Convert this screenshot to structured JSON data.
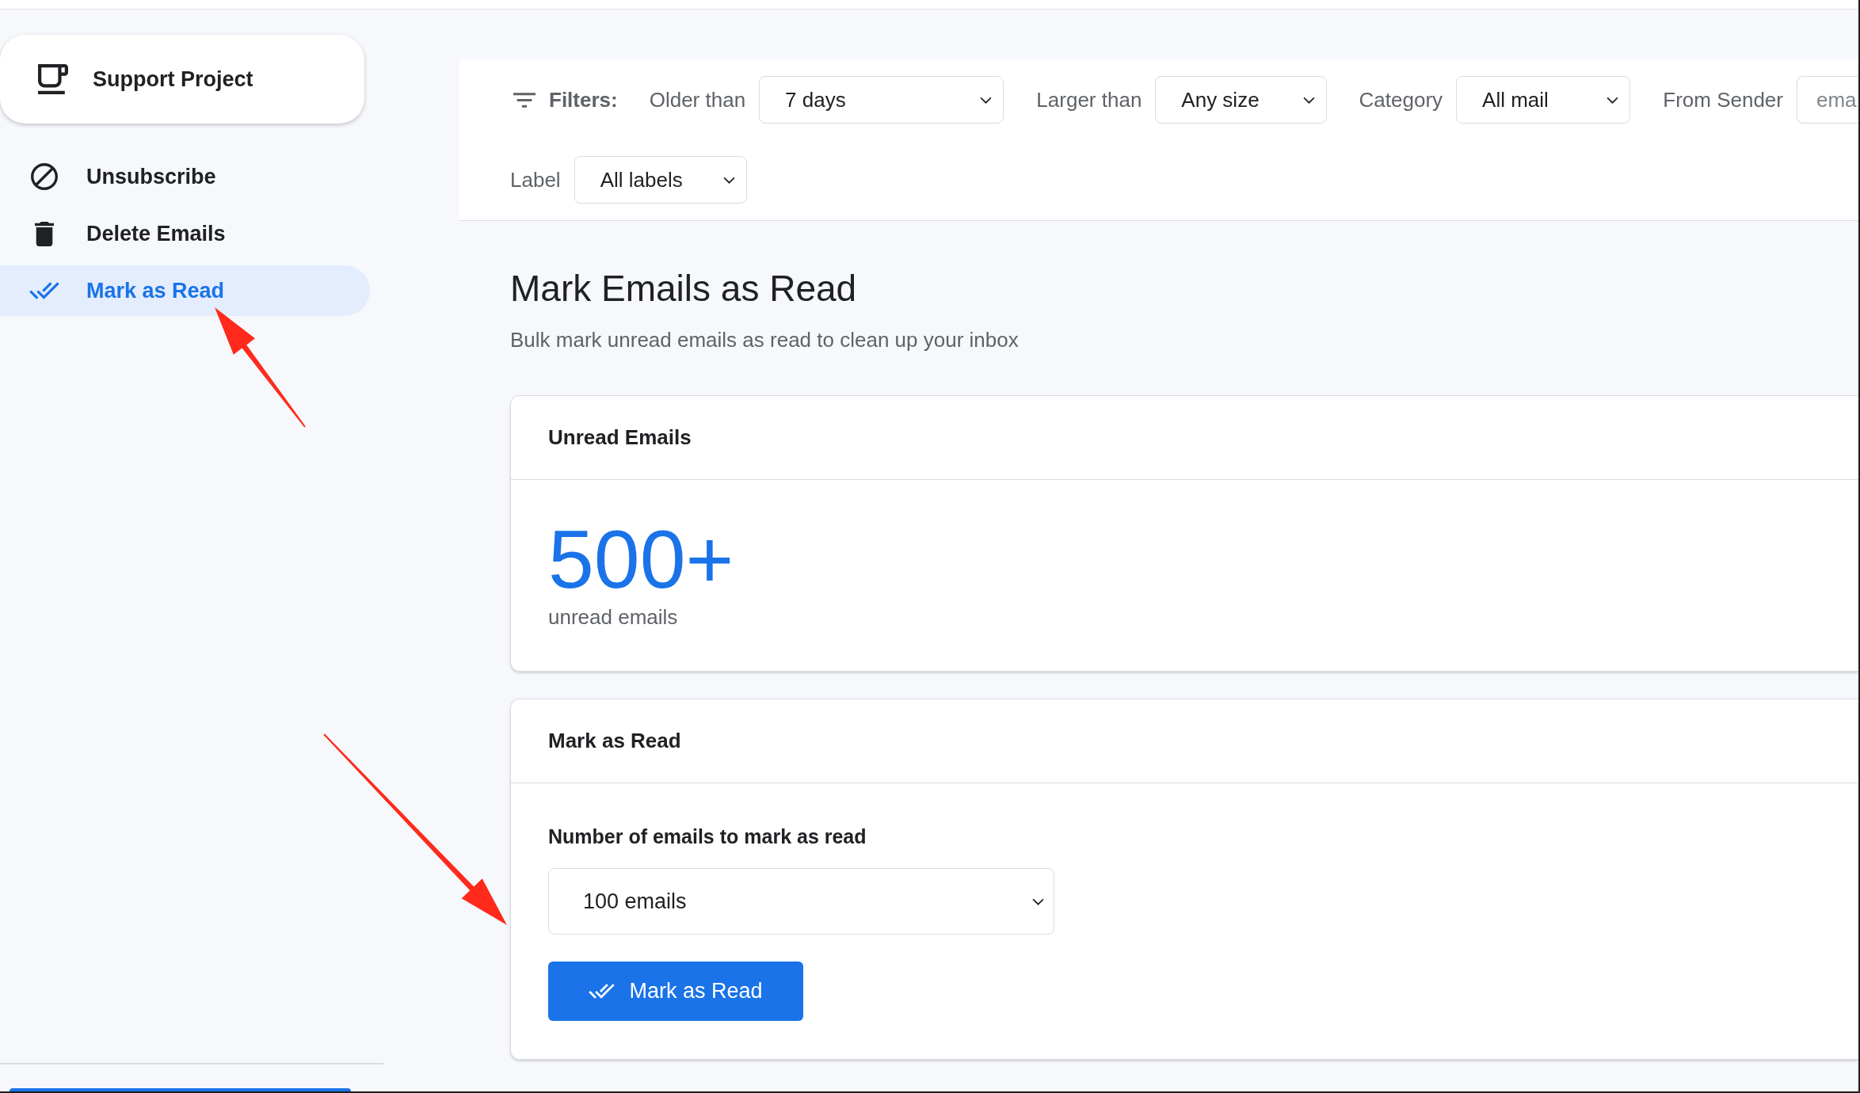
{
  "sidebar": {
    "support_button": {
      "label": "Support Project"
    },
    "items": [
      {
        "kind": "unsubscribe",
        "label": "Unsubscribe",
        "selected": false
      },
      {
        "kind": "delete",
        "label": "Delete Emails",
        "selected": false
      },
      {
        "kind": "markread",
        "label": "Mark as Read",
        "selected": true
      }
    ]
  },
  "filters": {
    "title": "Filters:",
    "rows": [
      {
        "items": [
          {
            "kind": "select",
            "label": "Older than",
            "value": "7 days"
          },
          {
            "kind": "select",
            "label": "Larger than",
            "value": "Any size"
          },
          {
            "kind": "select",
            "label": "Category",
            "value": "All mail"
          },
          {
            "kind": "input",
            "label": "From Sender",
            "placeholder": "ema"
          }
        ]
      },
      {
        "items": [
          {
            "kind": "select",
            "label": "Label",
            "value": "All labels"
          }
        ]
      }
    ]
  },
  "page": {
    "title": "Mark Emails as Read",
    "subtitle": "Bulk mark unread emails as read to clean up your inbox"
  },
  "unread_card": {
    "title": "Unread Emails",
    "count": "500+",
    "caption": "unread emails"
  },
  "action_card": {
    "title": "Mark as Read",
    "field_label": "Number of emails to mark as read",
    "select_value": "100 emails",
    "button": "Mark as Read"
  }
}
